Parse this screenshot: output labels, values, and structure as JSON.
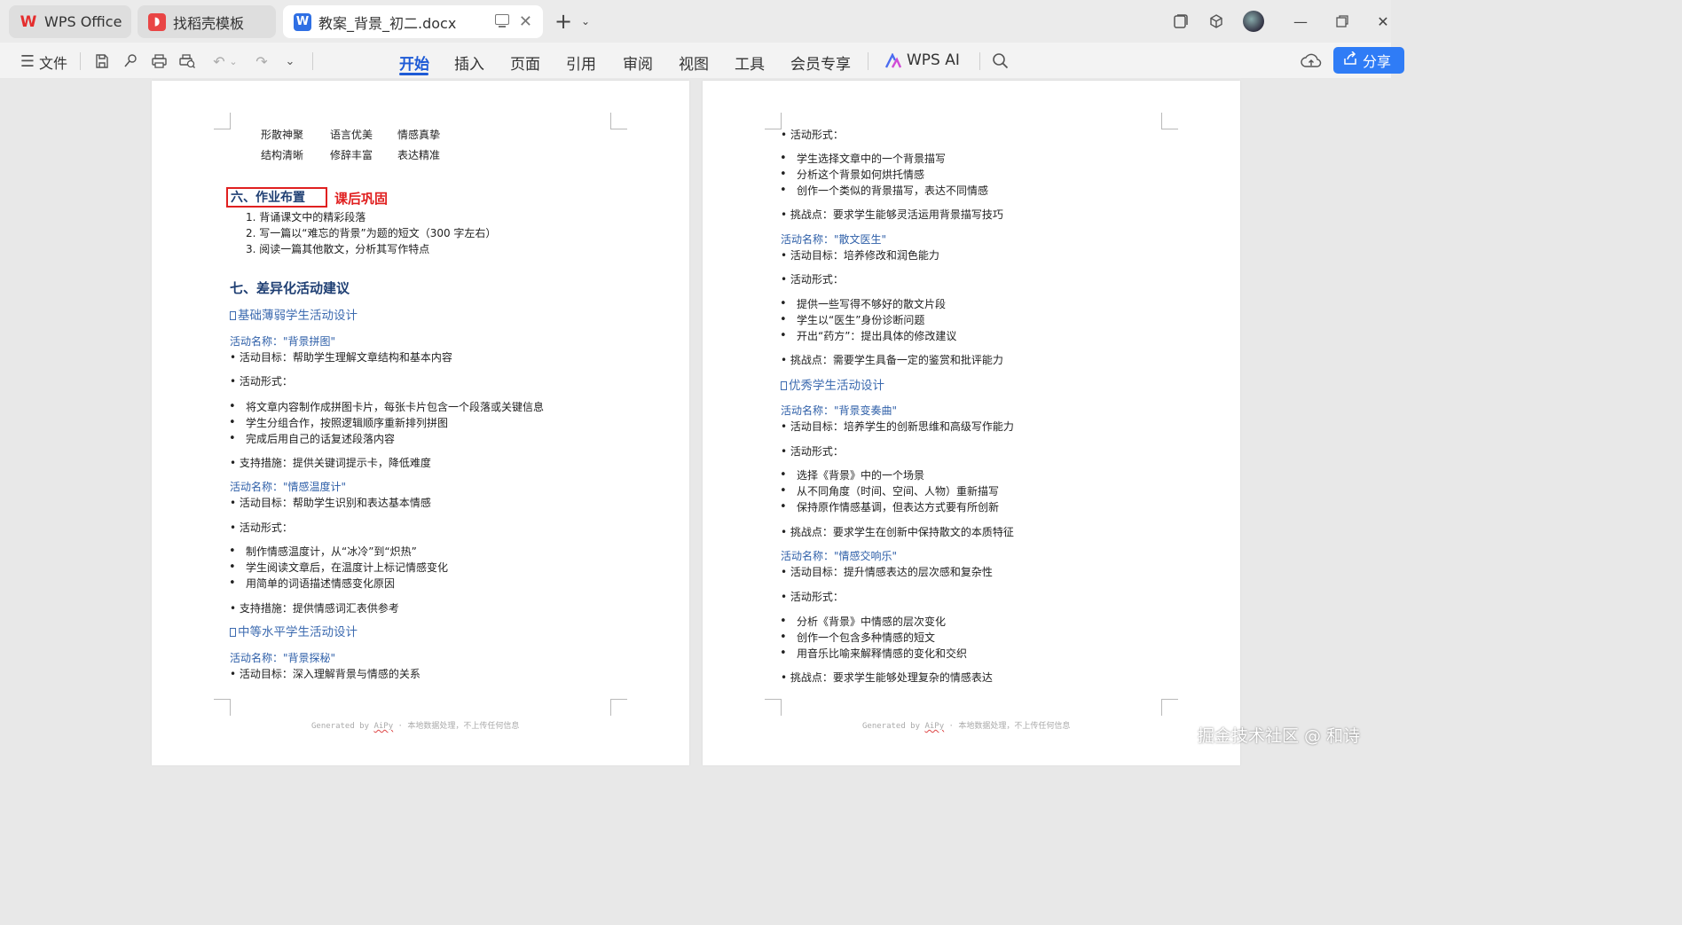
{
  "tabs": [
    {
      "label": "WPS Office",
      "icon": "wps-logo-icon",
      "active": false
    },
    {
      "label": "找稻壳模板",
      "icon": "docer-icon",
      "active": false
    },
    {
      "label": "教案_背景_初二.docx",
      "icon": "word-doc-icon",
      "active": true
    }
  ],
  "menubar": {
    "file_label": "文件",
    "items": [
      "开始",
      "插入",
      "页面",
      "引用",
      "审阅",
      "视图",
      "工具",
      "会员专享"
    ],
    "active": "开始",
    "wps_ai": "WPS AI",
    "share": "分享"
  },
  "left_page": {
    "words_row1": [
      "形散神聚",
      "语言优美",
      "情感真挚"
    ],
    "words_row2": [
      "结构清晰",
      "修辞丰富",
      "表达精准"
    ],
    "section6_title": "六、作业布置",
    "annotation": "课后巩固",
    "homework": [
      "1.  背诵课文中的精彩段落",
      "2.  写一篇以“难忘的背景”为题的短文（300 字左右）",
      "3.  阅读一篇其他散文，分析其写作特点"
    ],
    "section7_title": "七、差异化活动建议",
    "sub1": "基础薄弱学生活动设计",
    "act1_name": "活动名称：\"背景拼图\"",
    "act1_goal": "• 活动目标：帮助学生理解文章结构和基本内容",
    "act1_form": "• 活动形式：",
    "act1_items": [
      "将文章内容制作成拼图卡片，每张卡片包含一个段落或关键信息",
      "学生分组合作，按照逻辑顺序重新排列拼图",
      "完成后用自己的话复述段落内容"
    ],
    "act1_support": "• 支持措施：提供关键词提示卡，降低难度",
    "act2_name": "活动名称：\"情感温度计\"",
    "act2_goal": "• 活动目标：帮助学生识别和表达基本情感",
    "act2_form": "• 活动形式：",
    "act2_items": [
      "制作情感温度计，从“冰冷”到“炽热”",
      "学生阅读文章后，在温度计上标记情感变化",
      "用简单的词语描述情感变化原因"
    ],
    "act2_support": "• 支持措施：提供情感词汇表供参考",
    "sub2": "中等水平学生活动设计",
    "act3_name": "活动名称：\"背景探秘\"",
    "act3_goal": "• 活动目标：深入理解背景与情感的关系",
    "footer_prefix": "Generated by ",
    "footer_link": "AiPy",
    "footer_suffix": " · 本地数据处理，不上传任何信息"
  },
  "right_page": {
    "form1": "• 活动形式：",
    "items1": [
      "学生选择文章中的一个背景描写",
      "分析这个背景如何烘托情感",
      "创作一个类似的背景描写，表达不同情感"
    ],
    "challenge1": "• 挑战点：要求学生能够灵活运用背景描写技巧",
    "act_name2": "活动名称：\"散文医生\"",
    "goal2": "• 活动目标：培养修改和润色能力",
    "form2": "• 活动形式：",
    "items2": [
      "提供一些写得不够好的散文片段",
      "学生以“医生”身份诊断问题",
      "开出“药方”：提出具体的修改建议"
    ],
    "challenge2": "• 挑战点：需要学生具备一定的鉴赏和批评能力",
    "sub3": "优秀学生活动设计",
    "act_name3": "活动名称：\"背景变奏曲\"",
    "goal3": "• 活动目标：培养学生的创新思维和高级写作能力",
    "form3": "• 活动形式：",
    "items3": [
      "选择《背景》中的一个场景",
      "从不同角度（时间、空间、人物）重新描写",
      "保持原作情感基调，但表达方式要有所创新"
    ],
    "challenge3": "• 挑战点：要求学生在创新中保持散文的本质特征",
    "act_name4": "活动名称：\"情感交响乐\"",
    "goal4": "• 活动目标：提升情感表达的层次感和复杂性",
    "form4": "• 活动形式：",
    "items4": [
      "分析《背景》中情感的层次变化",
      "创作一个包含多种情感的短文",
      "用音乐比喻来解释情感的变化和交织"
    ],
    "challenge4": "• 挑战点：要求学生能够处理复杂的情感表达",
    "footer_prefix": "Generated by ",
    "footer_link": "AiPy",
    "footer_suffix": " · 本地数据处理，不上传任何信息"
  },
  "watermark": "掘金技术社区 @ 和诗",
  "colors": {
    "accent": "#1d5ad6",
    "share": "#2f7cf6",
    "annotation_red": "#e02020",
    "heading_blue": "#2e5fa8"
  }
}
